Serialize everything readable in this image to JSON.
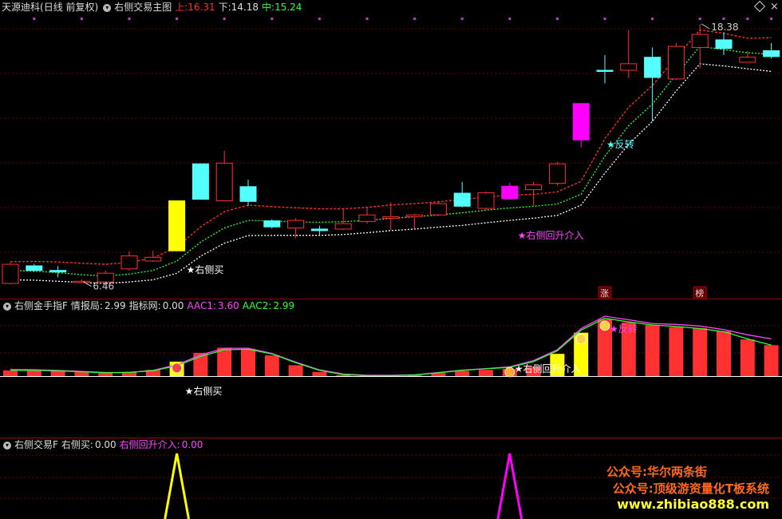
{
  "main_header": {
    "stock_name": "天源迪科",
    "period": "(日线 前复权)",
    "indicator_name": "右侧交易主图",
    "upper_label": "上:",
    "upper_value": "16.31",
    "lower_label": "下:",
    "lower_value": "14.18",
    "mid_label": "中:",
    "mid_value": "15.24"
  },
  "sub1_header": {
    "name": "右侧金手指F",
    "info_label": "情报局:",
    "info_value": "2.99",
    "net_label": "指标网:",
    "net_value": "0.00",
    "aac1_label": "AAC1:",
    "aac1_value": "3.60",
    "aac2_label": "AAC2:",
    "aac2_value": "2.99"
  },
  "sub2_header": {
    "name": "右侧交易F",
    "buy_label": "右侧买:",
    "buy_value": "0.00",
    "reentry_label": "右侧回升介入:",
    "reentry_value": "0.00"
  },
  "annotations": {
    "high_label": "18.38",
    "low_label": "6.46",
    "right_buy": "★右侧买",
    "reentry": "★右侧回升介入",
    "reversal": "★反转",
    "zhang_tag": "涨",
    "bang_tag": "榜"
  },
  "watermark": {
    "line1": "公众号:华尔两条街",
    "line2": "公众号:顶级游资量化T板系统",
    "line3": "www.zhibiao888.com"
  },
  "colors": {
    "up": "#ff3030",
    "down": "#54ffff",
    "signal": "#ff00ff",
    "buy": "#ffff00",
    "grid": "#7a0000",
    "upper_line": "#ff3030",
    "mid_line": "#30ff30",
    "lower_line": "#ffffff",
    "aac1": "#ff44ff",
    "aac2": "#30ff30"
  },
  "chart_data": [
    {
      "type": "candlestick",
      "title": "右侧交易主图",
      "candles": [
        {
          "o": 6.45,
          "c": 7.33,
          "h": 7.42,
          "l": 6.42,
          "color": "up"
        },
        {
          "o": 7.26,
          "c": 7.05,
          "h": 7.35,
          "l": 6.98,
          "color": "down"
        },
        {
          "o": 7.05,
          "c": 6.98,
          "h": 7.25,
          "l": 6.74,
          "color": "down"
        },
        {
          "o": 6.49,
          "c": 6.55,
          "h": 6.65,
          "l": 6.46,
          "color": "up"
        },
        {
          "o": 6.52,
          "c": 6.92,
          "h": 7.05,
          "l": 6.44,
          "color": "up"
        },
        {
          "o": 7.12,
          "c": 7.72,
          "h": 7.95,
          "l": 7.05,
          "color": "up"
        },
        {
          "o": 7.48,
          "c": 7.65,
          "h": 7.95,
          "l": 7.44,
          "color": "up"
        },
        {
          "o": 7.95,
          "c": 10.25,
          "h": 10.25,
          "l": 7.95,
          "color": "buy"
        },
        {
          "o": 11.95,
          "c": 10.32,
          "h": 11.95,
          "l": 10.3,
          "color": "down"
        },
        {
          "o": 10.25,
          "c": 11.98,
          "h": 12.55,
          "l": 10.22,
          "color": "up"
        },
        {
          "o": 10.9,
          "c": 10.22,
          "h": 11.22,
          "l": 10.0,
          "color": "down"
        },
        {
          "o": 9.33,
          "c": 9.05,
          "h": 9.4,
          "l": 8.98,
          "color": "down"
        },
        {
          "o": 9.0,
          "c": 9.35,
          "h": 9.45,
          "l": 8.52,
          "color": "up"
        },
        {
          "o": 8.95,
          "c": 8.88,
          "h": 9.1,
          "l": 8.66,
          "color": "down"
        },
        {
          "o": 8.95,
          "c": 9.2,
          "h": 9.9,
          "l": 8.9,
          "color": "up"
        },
        {
          "o": 9.3,
          "c": 9.6,
          "h": 9.95,
          "l": 9.2,
          "color": "up"
        },
        {
          "o": 9.45,
          "c": 9.52,
          "h": 10.18,
          "l": 8.91,
          "color": "up"
        },
        {
          "o": 9.52,
          "c": 9.6,
          "h": 9.65,
          "l": 8.96,
          "color": "up"
        },
        {
          "o": 9.6,
          "c": 10.12,
          "h": 10.25,
          "l": 9.55,
          "color": "up"
        },
        {
          "o": 10.6,
          "c": 10.0,
          "h": 11.12,
          "l": 9.95,
          "color": "down"
        },
        {
          "o": 9.9,
          "c": 10.62,
          "h": 10.68,
          "l": 9.85,
          "color": "up"
        },
        {
          "o": 10.92,
          "c": 10.35,
          "h": 11.08,
          "l": 10.3,
          "color": "signal"
        },
        {
          "o": 10.76,
          "c": 10.98,
          "h": 11.12,
          "l": 10.05,
          "color": "up"
        },
        {
          "o": 11.05,
          "c": 11.95,
          "h": 12.05,
          "l": 10.95,
          "color": "up"
        },
        {
          "o": 13.05,
          "c": 14.72,
          "h": 14.72,
          "l": 12.7,
          "color": "signal"
        },
        {
          "o": 16.25,
          "c": 16.25,
          "h": 16.95,
          "l": 15.65,
          "color": "down"
        },
        {
          "o": 16.25,
          "c": 16.55,
          "h": 18.1,
          "l": 15.9,
          "color": "up"
        },
        {
          "o": 16.85,
          "c": 15.92,
          "h": 17.3,
          "l": 13.9,
          "color": "down"
        },
        {
          "o": 15.85,
          "c": 17.35,
          "h": 17.5,
          "l": 15.8,
          "color": "up"
        },
        {
          "o": 17.3,
          "c": 17.9,
          "h": 18.38,
          "l": 16.35,
          "color": "up"
        },
        {
          "o": 17.65,
          "c": 17.25,
          "h": 18.0,
          "l": 16.95,
          "color": "down"
        },
        {
          "o": 16.62,
          "c": 16.85,
          "h": 17.15,
          "l": 16.7,
          "color": "up"
        },
        {
          "o": 17.15,
          "c": 16.88,
          "h": 17.5,
          "l": 16.8,
          "color": "down"
        }
      ],
      "upper": [
        7.45,
        7.46,
        7.44,
        7.38,
        7.33,
        7.42,
        7.62,
        8.12,
        9.05,
        9.75,
        10.05,
        9.98,
        9.93,
        9.88,
        9.88,
        9.95,
        10.06,
        10.12,
        10.2,
        10.31,
        10.42,
        10.5,
        10.55,
        10.66,
        11.15,
        13.1,
        14.55,
        15.55,
        16.85,
        18.1,
        17.95,
        17.72,
        17.75
      ],
      "mid": [
        7.05,
        7.02,
        6.95,
        6.85,
        6.8,
        6.88,
        7.05,
        7.48,
        8.35,
        9.0,
        9.35,
        9.32,
        9.28,
        9.26,
        9.29,
        9.35,
        9.44,
        9.52,
        9.6,
        9.7,
        9.82,
        9.92,
        10.0,
        10.1,
        10.55,
        12.3,
        13.7,
        14.7,
        16.05,
        17.35,
        17.2,
        17.05,
        17.0
      ],
      "lower": [
        6.62,
        6.6,
        6.55,
        6.5,
        6.45,
        6.52,
        6.62,
        6.92,
        7.7,
        8.3,
        8.65,
        8.66,
        8.66,
        8.66,
        8.7,
        8.78,
        8.88,
        8.95,
        9.04,
        9.12,
        9.24,
        9.35,
        9.45,
        9.58,
        10.05,
        11.52,
        12.85,
        13.9,
        15.3,
        16.55,
        16.45,
        16.32,
        16.2
      ],
      "signals": [
        {
          "index": 7,
          "text": "★右侧买"
        },
        {
          "index": 21,
          "text": "★右侧回升介入"
        },
        {
          "index": 25,
          "text": "★反转"
        }
      ]
    },
    {
      "type": "bar",
      "title": "右侧金手指F",
      "series": [
        {
          "name": "情报局",
          "values": [
            0.55,
            0.58,
            0.52,
            0.42,
            0.3,
            0.36,
            0.6,
            1.4,
            2.25,
            2.75,
            2.65,
            2.0,
            1.05,
            0.4,
            0.1,
            0.05,
            0.05,
            0.08,
            0.3,
            0.5,
            0.6,
            0.7,
            0.9,
            2.15,
            4.2,
            5.5,
            5.2,
            4.95,
            4.75,
            4.65,
            4.35,
            3.55,
            2.99
          ],
          "colors": [
            "red",
            "red",
            "red",
            "red",
            "red",
            "red",
            "red",
            "buy",
            "red",
            "red",
            "red",
            "red",
            "red",
            "red",
            "red",
            "red",
            "red",
            "red",
            "red",
            "red",
            "red",
            "red",
            "red",
            "buy",
            "buy",
            "red",
            "red",
            "red",
            "red",
            "red",
            "red",
            "red",
            "red"
          ]
        },
        {
          "name": "AAC1",
          "values": [
            0.65,
            0.62,
            0.55,
            0.45,
            0.35,
            0.35,
            0.55,
            1.1,
            2.05,
            2.7,
            2.7,
            2.2,
            1.35,
            0.6,
            0.2,
            0.08,
            0.08,
            0.12,
            0.35,
            0.58,
            0.72,
            0.9,
            1.5,
            2.55,
            4.6,
            5.8,
            5.45,
            5.1,
            5.0,
            4.85,
            4.5,
            4.0,
            3.6
          ]
        },
        {
          "name": "AAC2",
          "values": [
            0.55,
            0.55,
            0.5,
            0.42,
            0.32,
            0.36,
            0.52,
            1.0,
            1.9,
            2.55,
            2.6,
            2.15,
            1.3,
            0.55,
            0.15,
            0.05,
            0.05,
            0.1,
            0.32,
            0.55,
            0.7,
            0.85,
            1.4,
            2.45,
            4.45,
            5.6,
            5.25,
            4.95,
            4.8,
            4.6,
            4.3,
            3.6,
            2.99
          ]
        }
      ],
      "markers": [
        {
          "index": 7,
          "text": "★右侧买"
        },
        {
          "index": 21,
          "text": "★右侧回升介入"
        },
        {
          "index": 25,
          "text": "★反转"
        }
      ]
    },
    {
      "type": "line",
      "title": "右侧交易F",
      "series": [
        {
          "name": "右侧买",
          "values": [
            0,
            0,
            0,
            0,
            0,
            0,
            0,
            1,
            0,
            0,
            0,
            0,
            0,
            0,
            0,
            0,
            0,
            0,
            0,
            0,
            0,
            0,
            0,
            0,
            0,
            0,
            0,
            0,
            0,
            0,
            0,
            0,
            0
          ]
        },
        {
          "name": "右侧回升介入",
          "values": [
            0,
            0,
            0,
            0,
            0,
            0,
            0,
            0,
            0,
            0,
            0,
            0,
            0,
            0,
            0,
            0,
            0,
            0,
            0,
            0,
            0,
            1,
            0,
            0,
            0,
            0,
            0,
            0,
            0,
            0,
            0,
            0,
            0
          ]
        }
      ]
    }
  ]
}
